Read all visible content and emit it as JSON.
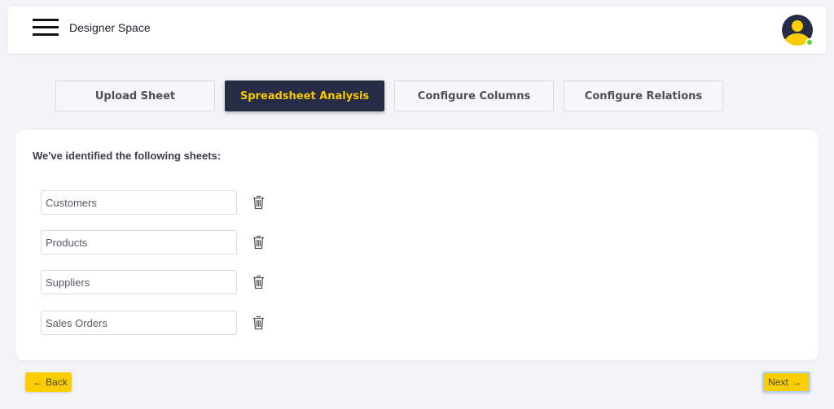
{
  "header": {
    "title": "Designer Space",
    "menu_icon": "hamburger-menu-icon",
    "avatar_icon": "user-avatar-icon",
    "avatar_status": "online",
    "colors": {
      "avatar_bg": "#262c45",
      "avatar_fg": "#fccd00",
      "status": "#5fd33b"
    }
  },
  "tabs": [
    {
      "label": "Upload Sheet",
      "active": false
    },
    {
      "label": "Spreadsheet Analysis",
      "active": true
    },
    {
      "label": "Configure Columns",
      "active": false
    },
    {
      "label": "Configure Relations",
      "active": false
    }
  ],
  "main": {
    "heading": "We've identified the following sheets:",
    "sheets": [
      {
        "value": "Customers",
        "delete_icon": "trash-icon"
      },
      {
        "value": "Products",
        "delete_icon": "trash-icon"
      },
      {
        "value": "Suppliers",
        "delete_icon": "trash-icon"
      },
      {
        "value": "Sales Orders",
        "delete_icon": "trash-icon"
      }
    ]
  },
  "footer": {
    "back_label": "Back",
    "back_icon": "←",
    "next_label": "Next",
    "next_icon": "→"
  },
  "colors": {
    "accent": "#fccd00",
    "active_tab_bg": "#262c45",
    "active_tab_text": "#f7c900",
    "page_bg": "#f3f3f8"
  }
}
